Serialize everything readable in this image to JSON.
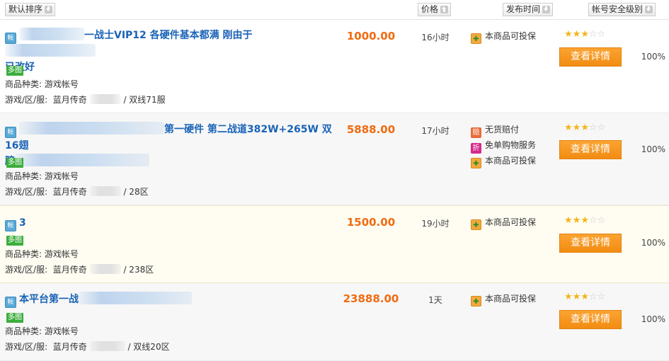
{
  "header": {
    "default_sort": "默认排序",
    "price": "价格",
    "publish_time": "发布时间",
    "security_level": "帐号安全级别"
  },
  "labels": {
    "category": "商品种类:",
    "game_server": "游戏/区/服:",
    "multi_image": "多图",
    "detail_button": "查看详情",
    "account_icon": "帐"
  },
  "listings": [
    {
      "title_line1": "一战士VIP12 各硬件基本都满 刚由于",
      "title_line2": "已改好",
      "price": "1000.00",
      "time": "16小时",
      "category": "游戏帐号",
      "server_prefix": "蓝月传奇",
      "server_suffix": "/ 双线71服",
      "services": [
        "本商品可投保"
      ],
      "stars": 3,
      "security_pct": "100%"
    },
    {
      "title_line1": "第一硬件 第二战道382W+265W 双16翅",
      "title_line2": "膀",
      "price": "5888.00",
      "time": "17小时",
      "category": "游戏帐号",
      "server_prefix": "蓝月传奇",
      "server_suffix": "/ 28区",
      "services": [
        "无货赔付",
        "免单购物服务",
        "本商品可投保"
      ],
      "stars": 3,
      "security_pct": "100%"
    },
    {
      "title_line1": "3",
      "title_line2": "",
      "price": "1500.00",
      "time": "19小时",
      "category": "游戏帐号",
      "server_prefix": "蓝月传奇",
      "server_suffix": "/ 238区",
      "services": [
        "本商品可投保"
      ],
      "stars": 3,
      "security_pct": "100%"
    },
    {
      "title_line1": "本平台第一战",
      "title_line2": "",
      "price": "23888.00",
      "time": "1天",
      "category": "游戏帐号",
      "server_prefix": "蓝月传奇",
      "server_suffix": "/ 双线20区",
      "services": [
        "本商品可投保"
      ],
      "stars": 3,
      "security_pct": "100%"
    }
  ],
  "service_icons": {
    "本商品可投保": "guard-icon",
    "无货赔付": "compensation-icon",
    "免单购物服务": "free-order-icon"
  },
  "colors": {
    "price": "#f06b11",
    "title_link": "#1a63b7",
    "detail_button": "#f28c12",
    "multi_image_badge": "#3cae3c",
    "star_on": "#f3b51a"
  }
}
